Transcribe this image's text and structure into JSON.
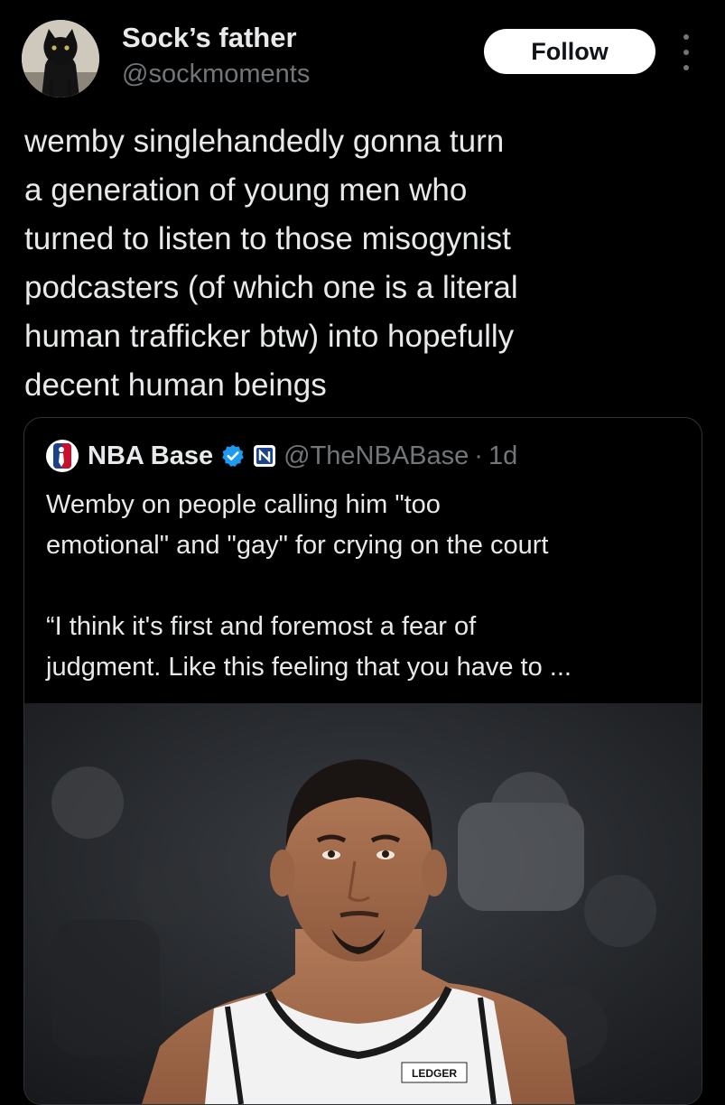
{
  "author": {
    "display_name": "Sock’s father",
    "handle": "@sockmoments",
    "avatar_icon": "black-cat-avatar"
  },
  "actions": {
    "follow_label": "Follow",
    "more_icon": "more-dots-icon"
  },
  "tweet": {
    "text": "wemby singlehandedly gonna turn\na generation of young men who\nturned to listen to those misogynist\npodcasters (of which one is a literal\nhuman trafficker btw) into hopefully\ndecent human beings"
  },
  "quoted": {
    "display_name": "NBA Base",
    "verified_icon": "verified-badge-icon",
    "affiliate_icon": "nba-affiliate-icon",
    "handle": "@TheNBABase",
    "separator": "·",
    "age": "1d",
    "text": "Wemby on people calling him \"too\nemotional\" and \"gay\" for crying on the court\n\n“I think it's first and foremost a fear of\njudgment. Like this feeling that you have to ...",
    "media": {
      "description_icon": "basketball-player-photo",
      "jersey_text": "LEDGER"
    }
  },
  "colors": {
    "background": "#000000",
    "text_primary": "#e7e9ea",
    "text_secondary": "#71767b",
    "border": "#2f3336",
    "verified_blue": "#1d9bf0",
    "follow_bg": "#ffffff"
  }
}
